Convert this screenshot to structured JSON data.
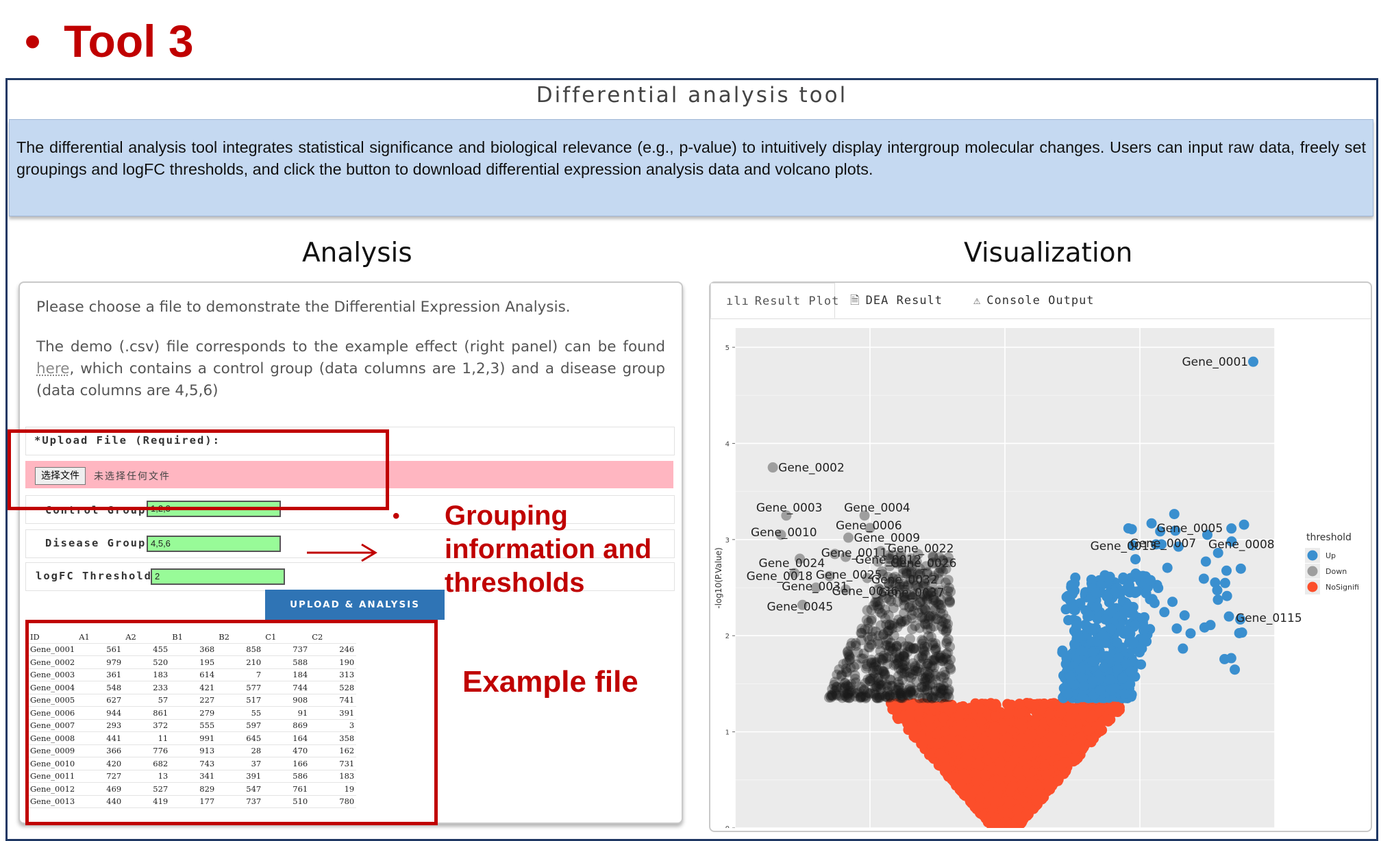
{
  "slide": {
    "bullet": "•",
    "title": "Tool 3"
  },
  "app": {
    "title": "Differential analysis tool",
    "description": "The differential analysis tool integrates statistical significance and biological relevance (e.g., p-value) to intuitively display intergroup molecular changes. Users can input raw data, freely set groupings and logFC thresholds, and click the button to download differential expression analysis data and volcano plots."
  },
  "analysis": {
    "heading": "Analysis",
    "intro1": "Please choose a file to demonstrate the Differential Expression Analysis.",
    "intro2_before": "The demo (.csv) file corresponds to the example effect (right panel) can be found ",
    "intro2_link": "here",
    "intro2_after": ", which contains a control group (data columns are 1,2,3) and a disease group (data columns are 4,5,6)",
    "upload_label": "*Upload File (Required):",
    "choose_file_button": "选择文件",
    "no_file_text": "未选择任何文件",
    "control_label": "Control Group:",
    "control_value": "1,2,3",
    "disease_label": "Disease Group:",
    "disease_value": "4,5,6",
    "logfc_label": "logFC Threshold:",
    "logfc_value": "2",
    "upload_button": "UPLOAD & ANALYSIS"
  },
  "example_table": {
    "headers": [
      "ID",
      "A1",
      "A2",
      "B1",
      "B2",
      "C1",
      "C2"
    ],
    "rows": [
      [
        "Gene_0001",
        "561",
        "455",
        "368",
        "858",
        "737",
        "246"
      ],
      [
        "Gene_0002",
        "979",
        "520",
        "195",
        "210",
        "588",
        "190"
      ],
      [
        "Gene_0003",
        "361",
        "183",
        "614",
        "7",
        "184",
        "313"
      ],
      [
        "Gene_0004",
        "548",
        "233",
        "421",
        "577",
        "744",
        "528"
      ],
      [
        "Gene_0005",
        "627",
        "57",
        "227",
        "517",
        "908",
        "741"
      ],
      [
        "Gene_0006",
        "944",
        "861",
        "279",
        "55",
        "91",
        "391"
      ],
      [
        "Gene_0007",
        "293",
        "372",
        "555",
        "597",
        "869",
        "3"
      ],
      [
        "Gene_0008",
        "441",
        "11",
        "991",
        "645",
        "164",
        "358"
      ],
      [
        "Gene_0009",
        "366",
        "776",
        "913",
        "28",
        "470",
        "162"
      ],
      [
        "Gene_0010",
        "420",
        "682",
        "743",
        "37",
        "166",
        "731"
      ],
      [
        "Gene_0011",
        "727",
        "13",
        "341",
        "391",
        "586",
        "183"
      ],
      [
        "Gene_0012",
        "469",
        "527",
        "829",
        "547",
        "761",
        "19"
      ],
      [
        "Gene_0013",
        "440",
        "419",
        "177",
        "737",
        "510",
        "780"
      ]
    ]
  },
  "annotations": {
    "grouping_bullet": "•",
    "grouping_lines": [
      "Grouping",
      "information and",
      "thresholds"
    ],
    "example_label": "Example file",
    "accent_color": "#c00000"
  },
  "visualization": {
    "heading": "Visualization",
    "tabs": [
      {
        "label": "Result Plot",
        "icon": "bar-chart-icon"
      },
      {
        "label": "DEA Result",
        "icon": "document-icon"
      },
      {
        "label": "Console Output",
        "icon": "warning-icon"
      }
    ]
  },
  "chart_data": {
    "type": "scatter",
    "title": "",
    "xlabel": "",
    "ylabel": "-log10(P.Value)",
    "ylim": [
      0,
      5.2
    ],
    "xlim": [
      -10,
      10
    ],
    "y_ticks": [
      "0",
      "1",
      "2",
      "3",
      "4",
      "5"
    ],
    "grid": true,
    "legend": {
      "title": "threshold",
      "placement": "right",
      "entries": [
        "Up",
        "Down",
        "NoSignifi"
      ]
    },
    "colors": {
      "Up": "#3a8fcf",
      "Down": "#9e9e9e",
      "NoSignifi": "#fc4e2a",
      "background": "#ebebeb"
    },
    "labeled_points": [
      {
        "label": "Gene_0001",
        "x": 9.2,
        "y": 4.85,
        "group": "Up"
      },
      {
        "label": "Gene_0002",
        "x": -8.6,
        "y": 3.75,
        "group": "Down"
      },
      {
        "label": "Gene_0003",
        "x": -8.1,
        "y": 3.25,
        "group": "Down"
      },
      {
        "label": "Gene_0004",
        "x": -5.2,
        "y": 3.25,
        "group": "Down"
      },
      {
        "label": "Gene_0006",
        "x": -5.0,
        "y": 3.12,
        "group": "Down"
      },
      {
        "label": "Gene_0010",
        "x": -8.3,
        "y": 3.05,
        "group": "Down"
      },
      {
        "label": "Gene_0009",
        "x": -5.8,
        "y": 3.02,
        "group": "Down"
      },
      {
        "label": "Gene_0022",
        "x": -4.6,
        "y": 2.88,
        "group": "Down"
      },
      {
        "label": "Gene_0011",
        "x": -6.3,
        "y": 2.85,
        "group": "Down"
      },
      {
        "label": "Gene_0012",
        "x": -5.9,
        "y": 2.82,
        "group": "Down"
      },
      {
        "label": "Gene_0024",
        "x": -7.6,
        "y": 2.8,
        "group": "Down"
      },
      {
        "label": "Gene_0026",
        "x": -4.7,
        "y": 2.77,
        "group": "Down"
      },
      {
        "label": "Gene_0018",
        "x": -7.8,
        "y": 2.65,
        "group": "Down"
      },
      {
        "label": "Gene_0025",
        "x": -6.5,
        "y": 2.62,
        "group": "Down"
      },
      {
        "label": "Gene_0032",
        "x": -5.1,
        "y": 2.6,
        "group": "Down"
      },
      {
        "label": "Gene_0031",
        "x": -7.0,
        "y": 2.5,
        "group": "Down"
      },
      {
        "label": "Gene_0036",
        "x": -5.9,
        "y": 2.48,
        "group": "Down"
      },
      {
        "label": "Gene_0037",
        "x": -4.8,
        "y": 2.45,
        "group": "Down"
      },
      {
        "label": "Gene_0045",
        "x": -7.5,
        "y": 2.32,
        "group": "Down"
      },
      {
        "label": "Gene_0005",
        "x": 7.5,
        "y": 3.05,
        "group": "Up"
      },
      {
        "label": "Gene_0007",
        "x": 5.8,
        "y": 2.95,
        "group": "Up"
      },
      {
        "label": "Gene_0013",
        "x": 5.6,
        "y": 2.95,
        "group": "Up"
      },
      {
        "label": "Gene_0008",
        "x": 8.4,
        "y": 2.98,
        "group": "Up"
      },
      {
        "label": "Gene_0115",
        "x": 8.3,
        "y": 2.2,
        "group": "Up"
      }
    ]
  }
}
